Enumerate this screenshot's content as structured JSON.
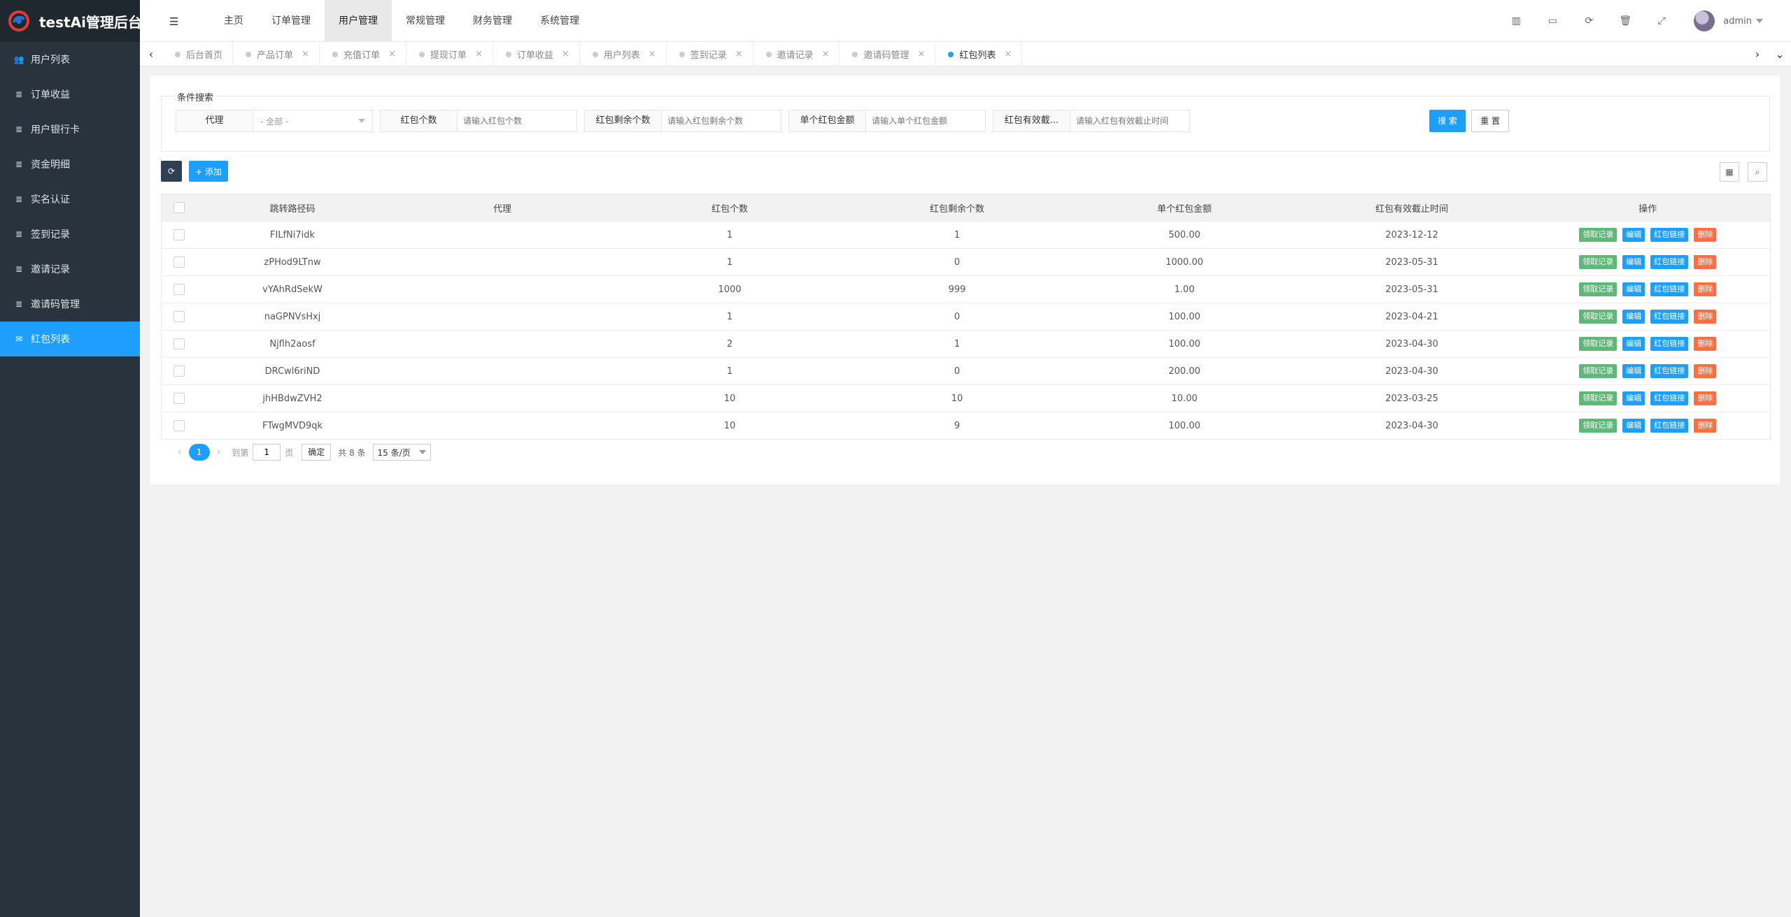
{
  "app": {
    "title": "testAi管理后台"
  },
  "colors": {
    "sidebar_bg": "#28333e",
    "primary": "#1e9fff",
    "green": "#5fb878",
    "red": "#ff5722"
  },
  "sidebar": {
    "items": [
      {
        "label": "用户列表",
        "icon": "users-icon"
      },
      {
        "label": "订单收益",
        "icon": "list-icon"
      },
      {
        "label": "用户银行卡",
        "icon": "list-icon"
      },
      {
        "label": "资金明细",
        "icon": "list-icon"
      },
      {
        "label": "实名认证",
        "icon": "list-icon"
      },
      {
        "label": "签到记录",
        "icon": "list-icon"
      },
      {
        "label": "邀请记录",
        "icon": "list-icon"
      },
      {
        "label": "邀请码管理",
        "icon": "list-icon"
      },
      {
        "label": "红包列表",
        "icon": "envelope-icon"
      }
    ]
  },
  "topnav": [
    "主页",
    "订单管理",
    "用户管理",
    "常规管理",
    "财务管理",
    "系统管理"
  ],
  "user": {
    "name": "admin"
  },
  "tabs": [
    "后台首页",
    "产品订单",
    "充值订单",
    "提现订单",
    "订单收益",
    "用户列表",
    "签到记录",
    "邀请记录",
    "邀请码管理",
    "红包列表"
  ],
  "search": {
    "legend": "条件搜索",
    "agent_label": "代理",
    "agent_value": "- 全部 -",
    "count_label": "红包个数",
    "count_placeholder": "请输入红包个数",
    "remain_label": "红包剩余个数",
    "remain_placeholder": "请输入红包剩余个数",
    "amount_label": "单个红包金额",
    "amount_placeholder": "请输入单个红包金额",
    "expire_label": "红包有效截...",
    "expire_placeholder": "请输入红包有效截止时间",
    "search_btn": "搜 索",
    "reset_btn": "重 置"
  },
  "toolbar": {
    "add_label": "+ 添加"
  },
  "table": {
    "headers": [
      "跳转路径码",
      "代理",
      "红包个数",
      "红包剩余个数",
      "单个红包金额",
      "红包有效截止时间",
      "操作"
    ],
    "actions": [
      "领取记录",
      "编辑",
      "红包链接",
      "删除"
    ],
    "rows": [
      [
        "FILfNi7idk",
        "",
        "1",
        "1",
        "500.00",
        "2023-12-12"
      ],
      [
        "zPHod9LTnw",
        "",
        "1",
        "0",
        "1000.00",
        "2023-05-31"
      ],
      [
        "vYAhRdSekW",
        "",
        "1000",
        "999",
        "1.00",
        "2023-05-31"
      ],
      [
        "naGPNVsHxj",
        "",
        "1",
        "0",
        "100.00",
        "2023-04-21"
      ],
      [
        "Njflh2aosf",
        "",
        "2",
        "1",
        "100.00",
        "2023-04-30"
      ],
      [
        "DRCwl6riND",
        "",
        "1",
        "0",
        "200.00",
        "2023-04-30"
      ],
      [
        "jhHBdwZVH2",
        "",
        "10",
        "10",
        "10.00",
        "2023-03-25"
      ],
      [
        "FTwgMVD9qk",
        "",
        "10",
        "9",
        "100.00",
        "2023-04-30"
      ]
    ]
  },
  "pager": {
    "current": "1",
    "goto_label": "到第",
    "goto_value": "1",
    "page_label": "页",
    "confirm": "确定",
    "total": "共 8 条",
    "limit": "15 条/页"
  }
}
